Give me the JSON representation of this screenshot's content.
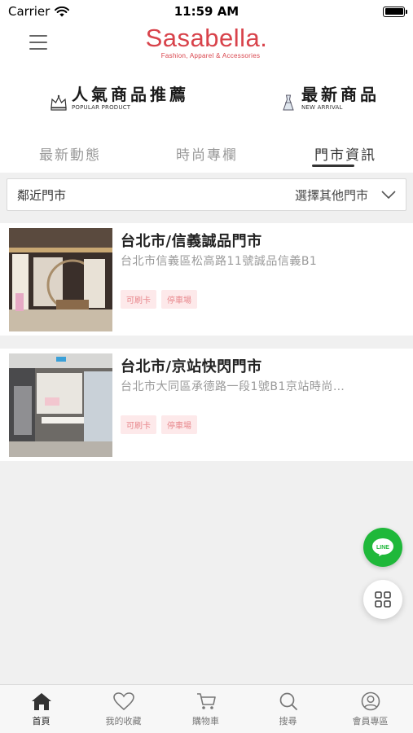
{
  "status_bar": {
    "carrier": "Carrier",
    "time": "11:59 AM"
  },
  "header": {
    "logo_title": "Sasabella.",
    "logo_subtitle": "Fashion, Apparel & Accessories"
  },
  "promo": {
    "popular": {
      "title": "人氣商品推薦",
      "subtitle": "POPULAR PRODUCT"
    },
    "new_arrival": {
      "title": "最新商品",
      "subtitle": "NEW ARRIVAL"
    }
  },
  "tabs": [
    {
      "label": "最新動態"
    },
    {
      "label": "時尚專欄"
    },
    {
      "label": "門市資訊"
    }
  ],
  "filter": {
    "current": "鄰近門市",
    "select_label": "選擇其他門市"
  },
  "stores": [
    {
      "name": "台北市/信義誠品門市",
      "address": "台北市信義區松高路11號誠品信義B1",
      "badges": [
        "可刷卡",
        "停車場"
      ]
    },
    {
      "name": "台北市/京站快閃門市",
      "address": "台北市大同區承德路一段1號B1京站時尚…",
      "badges": [
        "可刷卡",
        "停車場"
      ]
    }
  ],
  "fab": {
    "line_label": "LINE"
  },
  "tab_bar": [
    {
      "label": "首頁",
      "icon": "home-icon"
    },
    {
      "label": "我的收藏",
      "icon": "heart-icon"
    },
    {
      "label": "購物車",
      "icon": "cart-icon"
    },
    {
      "label": "搜尋",
      "icon": "search-icon"
    },
    {
      "label": "會員專區",
      "icon": "user-icon"
    }
  ],
  "colors": {
    "brand": "#d8434b",
    "line_green": "#1fb83a",
    "badge_text": "#e8878c",
    "badge_bg": "#fde9ea"
  }
}
